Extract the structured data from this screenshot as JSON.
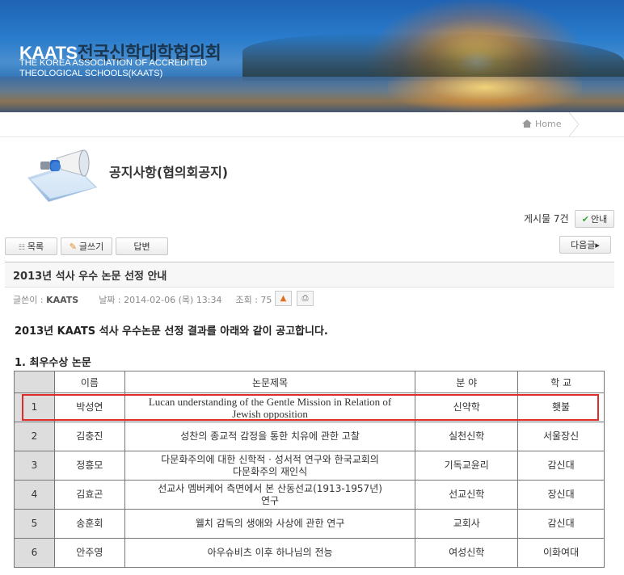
{
  "banner": {
    "logo_en": "KAATS",
    "logo_kr": "전국신학대학협의회",
    "logo_sub_line1": "THE KOREA ASSOCIATION OF ACCREDITED",
    "logo_sub_line2": "THEOLOGICAL SCHOOLS(KAATS)"
  },
  "breadcrumb": {
    "home_label": "Home"
  },
  "page": {
    "title": "공지사항(협의회공지)"
  },
  "board": {
    "count_label": "게시물 7건",
    "guide_label": "안내",
    "list_label": "목록",
    "write_label": "글쓰기",
    "reply_label": "답변",
    "next_label": "다음글"
  },
  "post": {
    "title": "2013년 석사 우수 논문 선정 안내",
    "author_label": "글쓴이 :",
    "author": "KAATS",
    "date_label": "날짜 :",
    "date": "2014-02-06 (목) 13:34",
    "views_label": "조회 :",
    "views": "75",
    "intro": "2013년 KAATS 석사 우수논문 선정 결과를 아래와 같이 공고합니다.",
    "section_title": "1. 최우수상 논문"
  },
  "table": {
    "headers": [
      "",
      "이름",
      "논문제목",
      "분 야",
      "학 교"
    ],
    "rows": [
      {
        "num": "1",
        "name": "박성연",
        "title_line1": "Lucan understanding of the Gentle Mission in Relation of",
        "title_line2": "Jewish opposition",
        "field": "신약학",
        "school": "횃불"
      },
      {
        "num": "2",
        "name": "김충진",
        "title_line1": "성찬의 종교적 감정을 통한 치유에 관한 고찰",
        "title_line2": "",
        "field": "실천신학",
        "school": "서울장신"
      },
      {
        "num": "3",
        "name": "정흥모",
        "title_line1": "다문화주의에 대한 신학적 · 성서적 연구와 한국교회의",
        "title_line2": "다문화주의 재인식",
        "field": "기독교윤리",
        "school": "감신대"
      },
      {
        "num": "4",
        "name": "김효곤",
        "title_line1": "선교사 멤버케어 측면에서 본 산동선교(1913-1957년)",
        "title_line2": "연구",
        "field": "선교신학",
        "school": "장신대"
      },
      {
        "num": "5",
        "name": "송훈회",
        "title_line1": "웰치 감독의 생애와 사상에 관한 연구",
        "title_line2": "",
        "field": "교회사",
        "school": "감신대"
      },
      {
        "num": "6",
        "name": "안주영",
        "title_line1": "아우슈비츠 이후 하나님의 전능",
        "title_line2": "",
        "field": "여성신학",
        "school": "이화여대"
      }
    ]
  },
  "colors": {
    "highlight": "#e12b2b",
    "banner": "#2a7ccc"
  }
}
